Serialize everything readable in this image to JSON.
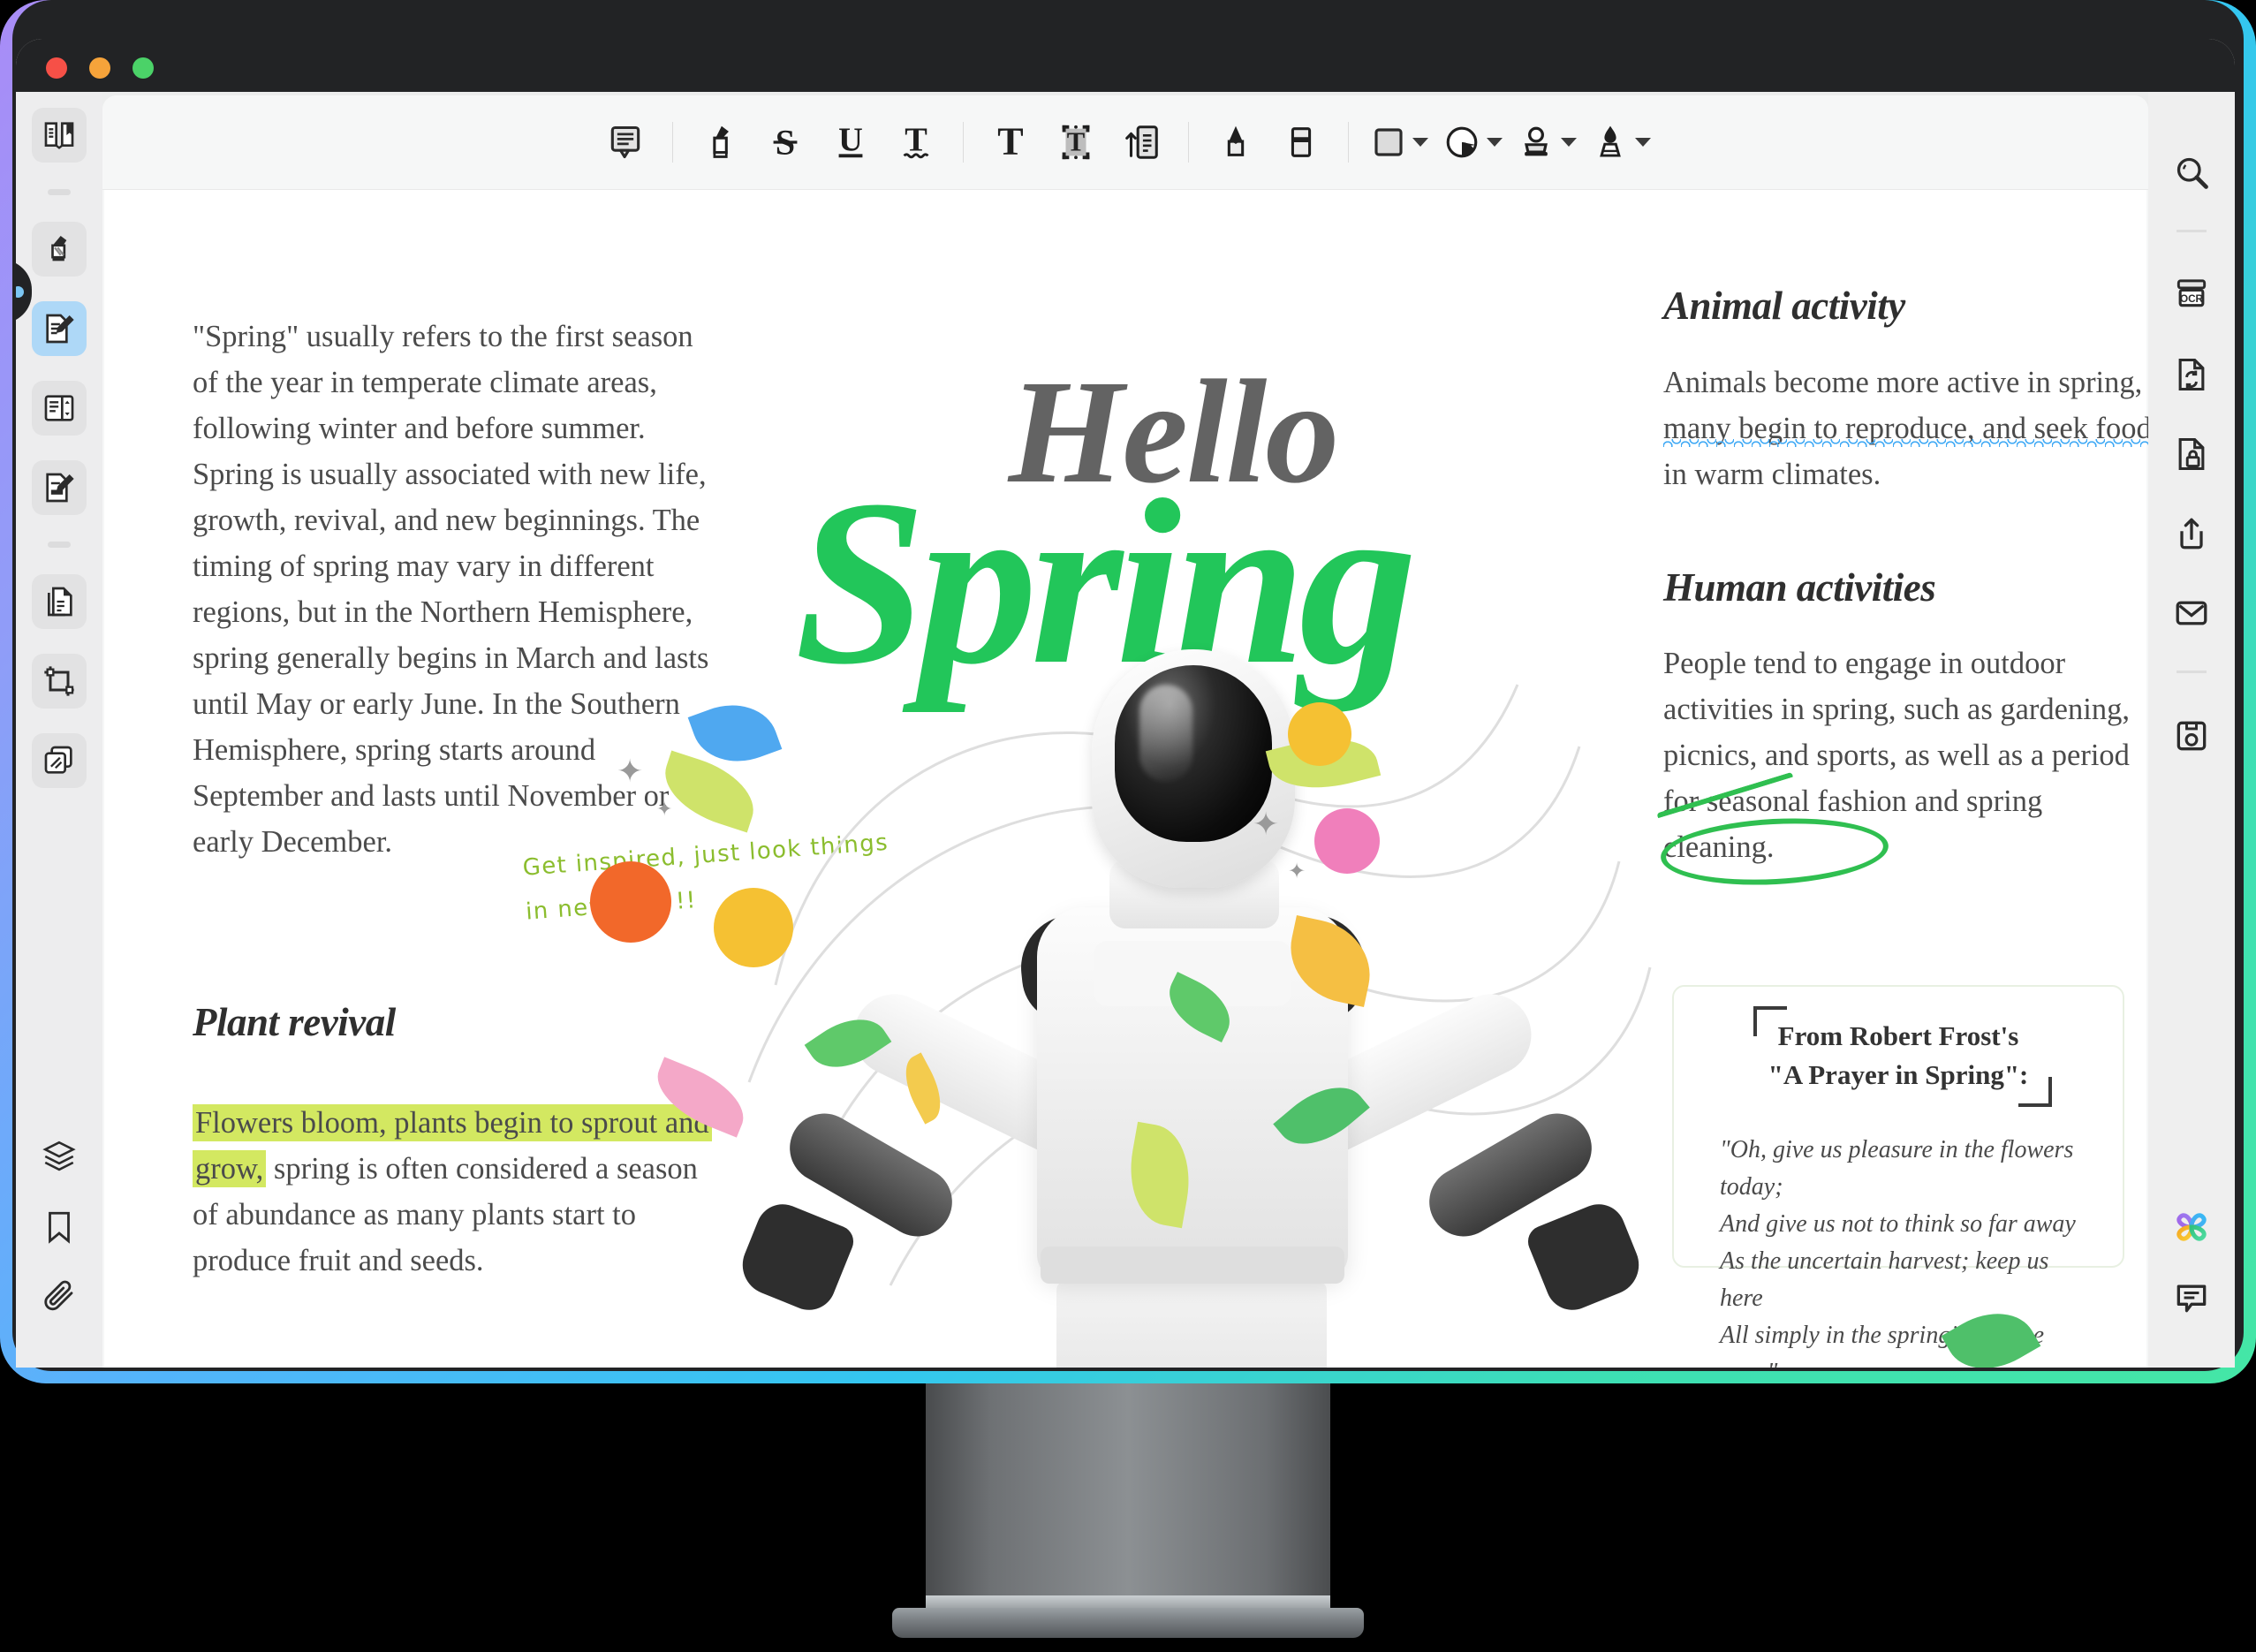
{
  "window": {
    "traffic_lights": [
      "close",
      "minimize",
      "zoom"
    ],
    "colors": {
      "close": "#f65047",
      "minimize": "#f6a33a",
      "zoom": "#4bd268",
      "accent_green": "#22c65a",
      "highlight_yellow": "#d3e861",
      "underline_red": "#e88b86",
      "squiggle_blue": "#3fa9f5",
      "annotation_green": "#2fbf50",
      "handwriting_green": "#8bbd2e"
    }
  },
  "left_rail": {
    "items": [
      {
        "name": "reader-view",
        "icon": "book-open-icon",
        "state": "chip"
      },
      {
        "name": "highlighter",
        "icon": "highlighter-icon",
        "state": "chip"
      },
      {
        "name": "annotate",
        "icon": "document-pen-icon",
        "state": "active"
      },
      {
        "name": "page-layout",
        "icon": "two-page-spread-icon",
        "state": "chip"
      },
      {
        "name": "edit-content",
        "icon": "document-edit-icon",
        "state": "chip"
      },
      {
        "name": "organize-pages",
        "icon": "page-stack-icon",
        "state": "chip"
      },
      {
        "name": "crop-pages",
        "icon": "crop-icon",
        "state": "chip"
      },
      {
        "name": "compare-files",
        "icon": "compare-documents-icon",
        "state": "chip"
      }
    ],
    "bottom_items": [
      {
        "name": "layers",
        "icon": "layers-icon"
      },
      {
        "name": "bookmarks",
        "icon": "bookmark-icon"
      },
      {
        "name": "attachments",
        "icon": "paperclip-icon"
      }
    ]
  },
  "toolbar": {
    "groups": [
      {
        "items": [
          {
            "name": "sticky-note",
            "icon": "comment-box-icon"
          }
        ]
      },
      {
        "items": [
          {
            "name": "highlight-text",
            "icon": "marker-pen-icon"
          },
          {
            "name": "strikethrough-text",
            "icon": "strikethrough-s-icon"
          },
          {
            "name": "underline-text",
            "icon": "underline-u-icon"
          },
          {
            "name": "squiggly-underline",
            "icon": "squiggly-t-icon"
          }
        ]
      },
      {
        "items": [
          {
            "name": "add-text",
            "icon": "text-t-icon"
          },
          {
            "name": "text-box",
            "icon": "text-box-icon"
          },
          {
            "name": "callout",
            "icon": "callout-arrow-icon"
          }
        ]
      },
      {
        "items": [
          {
            "name": "pencil",
            "icon": "pencil-icon"
          },
          {
            "name": "eraser",
            "icon": "eraser-icon"
          }
        ]
      },
      {
        "items": [
          {
            "name": "shapes",
            "icon": "square-shape-icon",
            "has_caret": true
          },
          {
            "name": "fill-color",
            "icon": "color-fill-icon",
            "has_caret": true
          },
          {
            "name": "stamp",
            "icon": "stamp-icon",
            "has_caret": true
          },
          {
            "name": "signature",
            "icon": "fountain-pen-icon",
            "has_caret": true
          }
        ]
      }
    ]
  },
  "right_rail": {
    "items": [
      {
        "name": "search",
        "icon": "magnifier-icon"
      },
      {
        "name": "ocr",
        "icon": "ocr-icon"
      },
      {
        "name": "convert",
        "icon": "document-convert-icon"
      },
      {
        "name": "protect",
        "icon": "document-lock-icon"
      },
      {
        "name": "share",
        "icon": "share-upload-icon"
      },
      {
        "name": "email",
        "icon": "envelope-icon"
      },
      {
        "name": "save",
        "icon": "floppy-save-icon"
      }
    ],
    "bottom_items": [
      {
        "name": "ai-assistant",
        "icon": "ai-clover-icon"
      },
      {
        "name": "comments-panel",
        "icon": "comment-bubble-icon"
      }
    ]
  },
  "document": {
    "hero": {
      "line1": "Hello",
      "line2": "Spring"
    },
    "left_column": {
      "paragraph_parts": [
        {
          "text": "\"Spring\" usually refers to the first season of the year in temperate climate areas, following ",
          "style": "plain"
        },
        {
          "text": "winter and before summer. Spring is usually associated with new life, growth, revival, and new beginnings. The timing of spring ",
          "style": "underline-red"
        },
        {
          "text": "may vary in different regions, but in the Northern Hemisphere, spring generally begins in March and lasts until May or early June. In the Southern Hemisphere, spring starts around September and lasts until November or early December.",
          "style": "plain"
        }
      ],
      "handwritten_note": "Get inspired, just look things in new way !!",
      "section_title": "Plant revival",
      "section_parts": [
        {
          "text": "Flowers bloom, plants begin to sprout and grow,",
          "style": "highlight"
        },
        {
          "text": " spring is often considered a season of abundance as many plants start to produce fruit and seeds.",
          "style": "plain"
        }
      ]
    },
    "right_column": {
      "section1_title": "Animal activity",
      "section1_parts": [
        {
          "text": "Animals become more active in spring, many begin to reproduce, and seek food",
          "style": "squiggly-blue"
        },
        {
          "text": " in warm climates.",
          "style": "plain"
        }
      ],
      "section2_title": "Human activities",
      "section2_parts": [
        {
          "text": "People tend to engage in outdoor ",
          "style": "plain"
        },
        {
          "text": "activities in spring,",
          "style": "circled-green"
        },
        {
          "text": " such as gardening, picnics, and sports, as well as a period for seasonal fashion and spring cleaning.",
          "style": "plain"
        }
      ],
      "quote_card": {
        "title_line1": "From Robert Frost's",
        "title_line2": "\"A Prayer in Spring\":",
        "lines": [
          "\"Oh, give us pleasure in the flowers today;",
          "And give us not to think so far away",
          "As the uncertain harvest; keep us here",
          "All simply in the springing of the year.\""
        ]
      }
    }
  }
}
